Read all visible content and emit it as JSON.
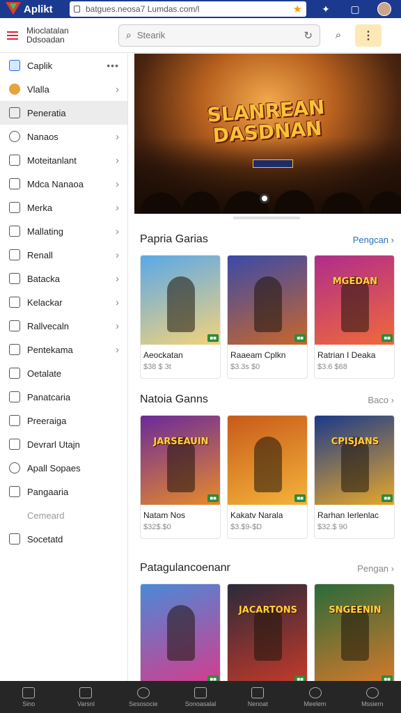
{
  "browser": {
    "brand": "Aplikt",
    "url": "batgues.neosa7 Lumdas.com/l",
    "icons": [
      "lock-icon",
      "star-icon",
      "extension-icon",
      "tab-icon",
      "profile-icon"
    ]
  },
  "header": {
    "title": "Mioclatalan Ddsoadan",
    "search_placeholder": "Stearik"
  },
  "sidebar": {
    "items": [
      {
        "label": "Caplik",
        "icon": "app-icon",
        "type": "dots"
      },
      {
        "label": "Vlalla",
        "icon": "avatar-icon",
        "type": "chevron"
      },
      {
        "label": "Peneratia",
        "icon": "list-icon",
        "type": "active"
      },
      {
        "label": "Nanaos",
        "icon": "search-icon",
        "type": "chevron"
      },
      {
        "label": "Moteitanlant",
        "icon": "image-icon",
        "type": "chevron"
      },
      {
        "label": "Mdca Nanaoa",
        "icon": "mail-icon",
        "type": "chevron"
      },
      {
        "label": "Merka",
        "icon": "frame-icon",
        "type": "chevron"
      },
      {
        "label": "Mallating",
        "icon": "chart-icon",
        "type": "chevron"
      },
      {
        "label": "Renall",
        "icon": "grid-icon",
        "type": "chevron"
      },
      {
        "label": "Batacka",
        "icon": "box-icon",
        "type": "chevron"
      },
      {
        "label": "Kelackar",
        "icon": "doc-icon",
        "type": "chevron"
      },
      {
        "label": "Rallvecaln",
        "icon": "pin-icon",
        "type": "chevron"
      },
      {
        "label": "Pentekama",
        "icon": "check-icon",
        "type": "chevron"
      },
      {
        "label": "Oetalate",
        "icon": "edit-icon",
        "type": "none"
      },
      {
        "label": "Panatcaria",
        "icon": "note-icon",
        "type": "none"
      },
      {
        "label": "Preeraiga",
        "icon": "card-icon",
        "type": "none"
      },
      {
        "label": "Devrarl Utajn",
        "icon": "pencil-icon",
        "type": "none"
      },
      {
        "label": "Apall Sopaes",
        "icon": "help-icon",
        "type": "none"
      },
      {
        "label": "Pangaaria",
        "icon": "square-icon",
        "type": "none"
      },
      {
        "label": "Cemeard",
        "icon": "blank-icon",
        "type": "muted"
      },
      {
        "label": "Socetatd",
        "icon": "dot-icon",
        "type": "none"
      }
    ]
  },
  "hero": {
    "title": "SLANREAN DASDNAN"
  },
  "sections": [
    {
      "title": "Papria Garias",
      "link": "Pengcan",
      "link_style": "blue",
      "cards": [
        {
          "name": "Aeockatan",
          "price": "$38 $ 3t",
          "img_title": "",
          "colors": [
            "#5aa8e8",
            "#f4d37a"
          ]
        },
        {
          "name": "Raaeam Cplkn",
          "price": "$3.3s $0",
          "img_title": "",
          "colors": [
            "#3a4aa8",
            "#c8672a"
          ]
        },
        {
          "name": "Ratrian I Deaka",
          "price": "$3.6 $68",
          "img_title": "MGEDAN",
          "colors": [
            "#b02c8a",
            "#f06a3a"
          ]
        }
      ]
    },
    {
      "title": "Natoia Ganns",
      "link": "Baco",
      "link_style": "grey",
      "cards": [
        {
          "name": "Natam Nos",
          "price": "$32$.$0",
          "img_title": "JARSEAUIN",
          "colors": [
            "#6a2a9a",
            "#e88a2a"
          ]
        },
        {
          "name": "Kakatv Narala",
          "price": "$3.$9-$D",
          "img_title": "",
          "colors": [
            "#c85a1a",
            "#f4b43a"
          ]
        },
        {
          "name": "Rarhan Ierlenlac",
          "price": "$32.$ 90",
          "img_title": "CPISJANS",
          "colors": [
            "#1a3a8a",
            "#e8a82a"
          ]
        }
      ]
    },
    {
      "title": "Patagulancoenanr",
      "link": "Pengan",
      "link_style": "grey",
      "cards": [
        {
          "name": "",
          "price": "",
          "img_title": "",
          "colors": [
            "#4a8ad8",
            "#d83a8a"
          ]
        },
        {
          "name": "",
          "price": "",
          "img_title": "JACARTONS",
          "colors": [
            "#2a2a3a",
            "#c83a2a"
          ]
        },
        {
          "name": "",
          "price": "",
          "img_title": "SNGEENIN",
          "colors": [
            "#2a6a3a",
            "#d87a2a"
          ]
        }
      ]
    }
  ],
  "bottom_nav": {
    "items": [
      {
        "label": "Sino",
        "icon": "home-icon"
      },
      {
        "label": "Varsnl",
        "icon": "bars-icon"
      },
      {
        "label": "Sesosocie",
        "icon": "search-icon"
      },
      {
        "label": "Sonoasalal",
        "icon": "store-icon"
      },
      {
        "label": "Nenoat",
        "icon": "bag-icon"
      },
      {
        "label": "Meelem",
        "icon": "circle-icon"
      },
      {
        "label": "Mssiern",
        "icon": "user-icon"
      }
    ]
  }
}
